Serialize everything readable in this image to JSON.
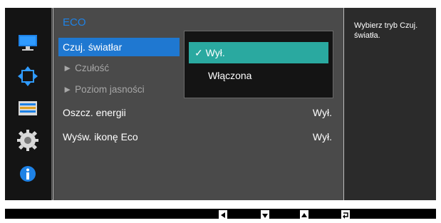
{
  "menu": {
    "title": "ECO",
    "items": [
      {
        "label": "Czuj. światłar",
        "value": ""
      },
      {
        "label": "► Czułość",
        "value": ""
      },
      {
        "label": "► Poziom jasności",
        "value": ""
      },
      {
        "label": "Oszcz. energii",
        "value": "Wył."
      },
      {
        "label": "Wyśw. ikonę Eco",
        "value": "Wył."
      }
    ]
  },
  "popup": {
    "check": "✓",
    "options": [
      {
        "label": "Wył.",
        "selected": true
      },
      {
        "label": "Włączona",
        "selected": false
      }
    ]
  },
  "help": {
    "text": "Wybierz tryb Czuj. światła."
  },
  "colors": {
    "accent_blue": "#1f78d1",
    "title_blue": "#1e82e6",
    "selected_teal": "#2aa9a0",
    "panel": "#4a4a4a",
    "background": "#2b2b2b"
  },
  "icons": [
    "monitor-icon",
    "resize-arrows-icon",
    "settings-bars-icon",
    "gear-icon",
    "info-icon"
  ],
  "bottom_bar": {
    "buttons": [
      "left-arrow-icon",
      "down-arrow-icon",
      "up-arrow-icon",
      "return-icon"
    ]
  }
}
